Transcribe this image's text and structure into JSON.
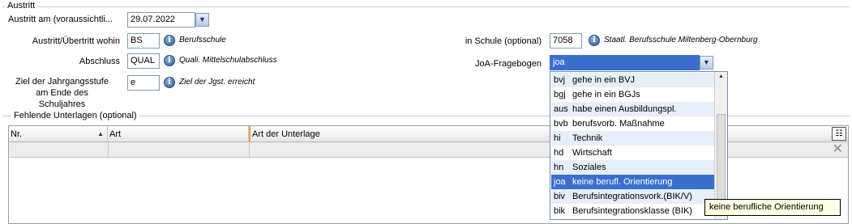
{
  "austritt": {
    "legend": "Austritt",
    "date_label": "Austritt am (voraussichtli...",
    "date_value": "29.07.2022",
    "wohin_label": "Austritt/Übertritt wohin",
    "wohin_value": "BS",
    "wohin_hint": "Berufsschule",
    "abschluss_label": "Abschluss",
    "abschluss_value": "QUAL",
    "abschluss_hint": "Quali. Mittelschulabschluss",
    "ziel_label_1": "Ziel der Jahrgangsstufe",
    "ziel_label_2": "am Ende des",
    "ziel_label_3": "Schuljahres",
    "ziel_value": "e",
    "ziel_hint": "Ziel der Jgst. erreicht",
    "schule_label": "in Schule (optional)",
    "schule_value": "7058",
    "schule_hint": "Staatl. Berufsschule Miltenberg-Obernburg",
    "joa_label": "JoA-Fragebogen",
    "joa_value": "joa"
  },
  "fehlende": {
    "legend": "Fehlende Unterlagen (optional)",
    "columns": [
      "Nr.",
      "Art",
      "Art der Unterlage"
    ]
  },
  "joa_options": [
    {
      "code": "bvj",
      "text": "gehe in ein BVJ"
    },
    {
      "code": "bgj",
      "text": "gehe in ein BGJs"
    },
    {
      "code": "aus",
      "text": "habe einen Ausbildungspl."
    },
    {
      "code": "bvb",
      "text": "berufsvorb. Maßnahme"
    },
    {
      "code": "hi",
      "text": "Technik"
    },
    {
      "code": "hd",
      "text": "Wirtschaft"
    },
    {
      "code": "hn",
      "text": "Soziales"
    },
    {
      "code": "joa",
      "text": "keine berufl. Orientierung"
    },
    {
      "code": "biv",
      "text": "Berufsintegrationsvork.(BIK/V)"
    },
    {
      "code": "bik",
      "text": "Berufsintegrationsklasse (BIK)"
    }
  ],
  "tooltip": "keine berufliche Orientierung",
  "icons": {
    "info": "info-icon",
    "dropdown": "chevron-down-icon",
    "sort": "sort-ascending-icon",
    "clear": "clear-filter-icon",
    "columns": "column-chooser-icon"
  },
  "colors": {
    "selection": "#3a6fcf",
    "alt_row": "#e6eef9",
    "tooltip_bg": "#ffffe1"
  }
}
